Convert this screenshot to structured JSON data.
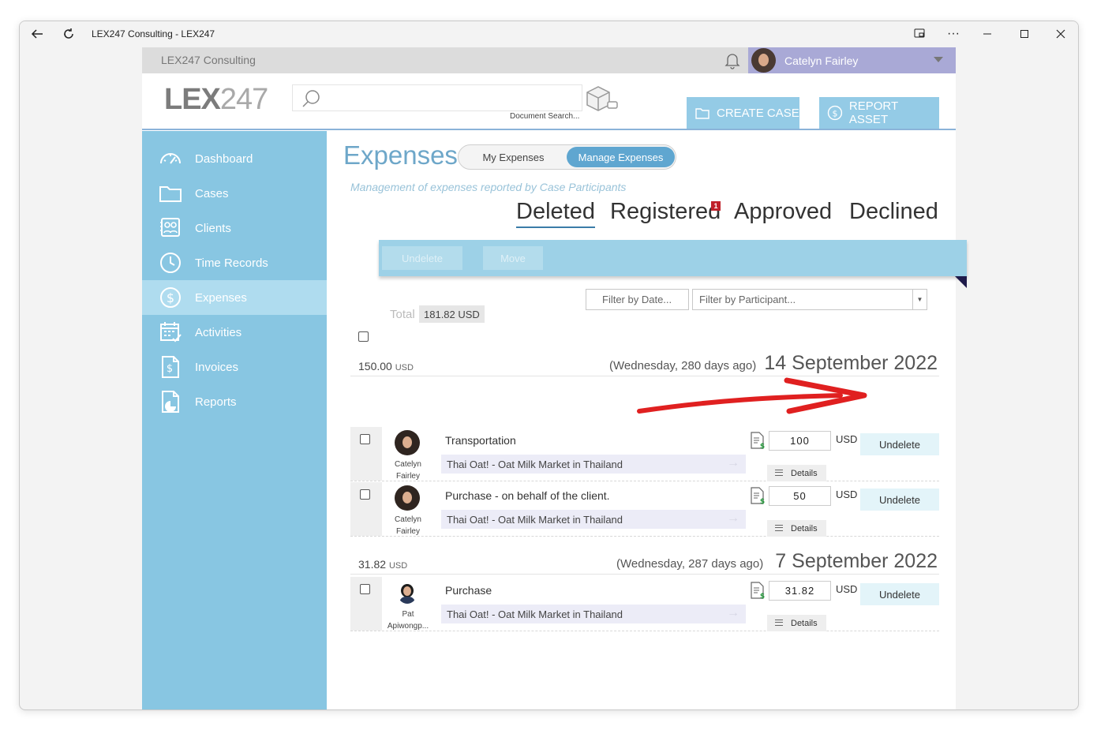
{
  "window": {
    "title": "LEX247 Consulting - LEX247"
  },
  "topbar": {
    "org": "LEX247 Consulting",
    "user_name": "Catelyn Fairley"
  },
  "header": {
    "logo_bold": "LEX",
    "logo_thin": "247",
    "search_placeholder": "",
    "doc_search_label": "Document Search...",
    "create_case_label": "CREATE CASE",
    "report_asset_label": "REPORT ASSET"
  },
  "sidebar": {
    "items": [
      {
        "label": "Dashboard",
        "icon": "gauge-icon"
      },
      {
        "label": "Cases",
        "icon": "folder-icon"
      },
      {
        "label": "Clients",
        "icon": "contacts-icon"
      },
      {
        "label": "Time Records",
        "icon": "clock-icon"
      },
      {
        "label": "Expenses",
        "icon": "dollar-circle-icon",
        "active": true
      },
      {
        "label": "Activities",
        "icon": "calendar-check-icon"
      },
      {
        "label": "Invoices",
        "icon": "invoice-icon"
      },
      {
        "label": "Reports",
        "icon": "report-chart-icon"
      }
    ]
  },
  "main": {
    "title": "Expenses",
    "seg_my": "My Expenses",
    "seg_manage": "Manage Expenses",
    "subtitle": "Management of expenses reported by Case Participants",
    "tabs": {
      "deleted": "Deleted",
      "registered": "Registered",
      "registered_badge": "1",
      "approved": "Approved",
      "declined": "Declined"
    },
    "toolbar": {
      "undelete": "Undelete",
      "move": "Move"
    },
    "filters": {
      "date_placeholder": "Filter by Date...",
      "participant_placeholder": "Filter by Participant..."
    },
    "total_label": "Total",
    "total_value": "181.82 USD"
  },
  "groups": [
    {
      "sum": "150.00",
      "sum_cur": "USD",
      "days": "(Wednesday, 280 days ago)",
      "date": "14 September 2022",
      "rows": [
        {
          "participant_first": "Catelyn",
          "participant_last": "Fairley",
          "description": "Transportation",
          "case": "Thai Oat! - Oat Milk Market in Thailand",
          "amount": "100",
          "currency": "USD",
          "action": "Undelete",
          "details": "Details"
        },
        {
          "participant_first": "Catelyn",
          "participant_last": "Fairley",
          "description": "Purchase - on behalf of the client.",
          "case": "Thai Oat! - Oat Milk Market in Thailand",
          "amount": "50",
          "currency": "USD",
          "action": "Undelete",
          "details": "Details"
        }
      ]
    },
    {
      "sum": "31.82",
      "sum_cur": "USD",
      "days": "(Wednesday, 287 days ago)",
      "date": "7 September 2022",
      "rows": [
        {
          "participant_first": "Pat",
          "participant_last": "Apiwongp...",
          "description": "Purchase",
          "case": "Thai Oat! - Oat Milk Market in Thailand",
          "amount": "31.82",
          "currency": "USD",
          "action": "Undelete",
          "details": "Details"
        }
      ]
    }
  ],
  "colors": {
    "sidebar": "#88c6e2",
    "sidebar_active": "#afdcef",
    "accent": "#5fa6d0",
    "annotation_arrow": "#e02020"
  }
}
